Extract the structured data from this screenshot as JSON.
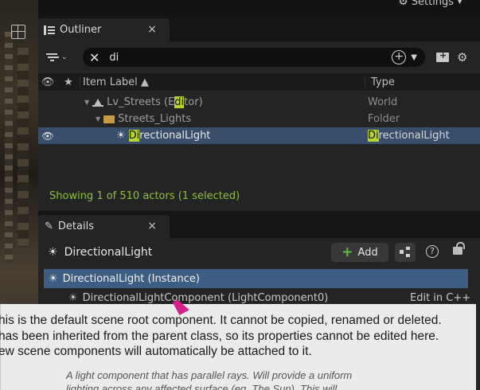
{
  "topbar": {
    "settings_label": "Settings"
  },
  "outliner": {
    "tab_label": "Outliner",
    "close_label": "×",
    "search": {
      "value": "di"
    },
    "columns": {
      "label": "Item Label ▲",
      "type": "Type"
    },
    "rows": [
      {
        "pre": "Lv_Streets (E",
        "match": "di",
        "post": "tor)",
        "type_pre": "World",
        "type_match": "",
        "type_post": ""
      },
      {
        "pre": "Streets_Lights",
        "match": "",
        "post": "",
        "type_pre": "Folder",
        "type_match": "",
        "type_post": ""
      },
      {
        "pre": "",
        "match": "Di",
        "post": "rectionalLight",
        "type_pre": "",
        "type_match": "Di",
        "type_post": "rectionalLight"
      }
    ],
    "status": "Showing 1 of 510 actors (1 selected)"
  },
  "details": {
    "tab_label": "Details",
    "close_label": "×",
    "title": "DirectionalLight",
    "add_label": "Add",
    "help_label": "?",
    "instance_label": "DirectionalLight (Instance)",
    "component": {
      "label": "DirectionalLightComponent (LightComponent0)",
      "edit": "Edit in C++"
    }
  },
  "tooltip": {
    "line1": "his is the default scene root component. It cannot be copied, renamed or deleted.",
    "line2": "has been inherited from the parent class, so its properties cannot be edited here.",
    "line3": "ew scene components will automatically be attached to it.",
    "desc1": "A light component that has parallel rays. Will provide a uniform",
    "desc2": "lighting across any affected surface (eg. The Sun). This will"
  },
  "colors": {
    "selection": "#384e6b",
    "instance": "#3d5d82",
    "search_highlight": "#b9d32e",
    "status": "#8fbf3a",
    "add_plus": "#5cc240",
    "cursor": "#d6208a"
  }
}
